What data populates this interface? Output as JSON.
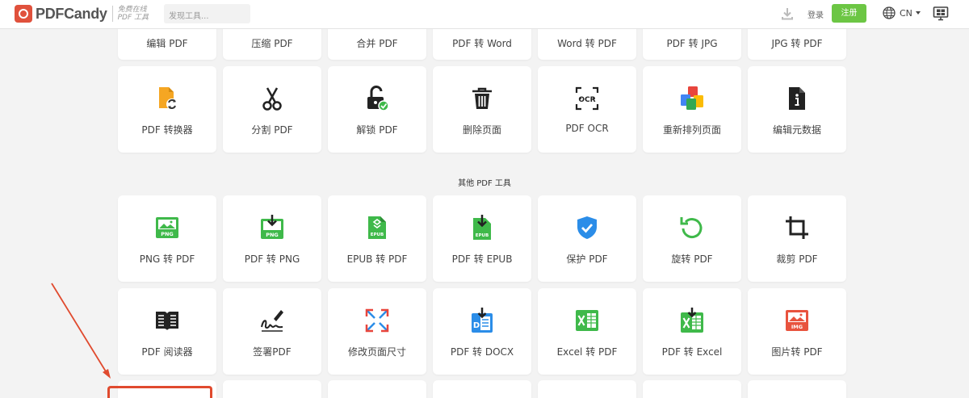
{
  "header": {
    "brand": "PDFCandy",
    "tagline_1": "免费在线",
    "tagline_2": "PDF 工具",
    "search_placeholder": "发现工具...",
    "login": "登录",
    "signup": "注册",
    "language": "CN"
  },
  "top_row": [
    {
      "label": "编辑 PDF"
    },
    {
      "label": "压缩 PDF"
    },
    {
      "label": "合并 PDF"
    },
    {
      "label": "PDF 转 Word"
    },
    {
      "label": "Word 转 PDF"
    },
    {
      "label": "PDF 转 JPG"
    },
    {
      "label": "JPG 转 PDF"
    }
  ],
  "row_2": [
    {
      "label": "PDF 转换器",
      "icon": "pdf-converter-icon"
    },
    {
      "label": "分割 PDF",
      "icon": "scissors-icon"
    },
    {
      "label": "解锁 PDF",
      "icon": "unlock-icon"
    },
    {
      "label": "删除页面",
      "icon": "trash-icon"
    },
    {
      "label": "PDF OCR",
      "icon": "ocr-icon"
    },
    {
      "label": "重新排列页面",
      "icon": "rearrange-icon"
    },
    {
      "label": "编辑元数据",
      "icon": "metadata-icon"
    }
  ],
  "section_title": "其他 PDF 工具",
  "row_3": [
    {
      "label": "PNG 转 PDF",
      "icon": "png-icon"
    },
    {
      "label": "PDF 转 PNG",
      "icon": "png-download-icon"
    },
    {
      "label": "EPUB 转 PDF",
      "icon": "epub-icon"
    },
    {
      "label": "PDF 转 EPUB",
      "icon": "epub-download-icon"
    },
    {
      "label": "保护 PDF",
      "icon": "shield-icon"
    },
    {
      "label": "旋转 PDF",
      "icon": "rotate-icon"
    },
    {
      "label": "裁剪 PDF",
      "icon": "crop-icon"
    }
  ],
  "row_4": [
    {
      "label": "PDF 阅读器",
      "icon": "book-icon"
    },
    {
      "label": "签署PDF",
      "icon": "signature-icon"
    },
    {
      "label": "修改页面尺寸",
      "icon": "resize-icon"
    },
    {
      "label": "PDF 转 DOCX",
      "icon": "docx-icon"
    },
    {
      "label": "Excel 转 PDF",
      "icon": "excel-icon"
    },
    {
      "label": "PDF 转 Excel",
      "icon": "excel-download-icon"
    },
    {
      "label": "图片转 PDF",
      "icon": "image-icon"
    }
  ],
  "colors": {
    "accent_green": "#6cc644",
    "brand_red": "#e0513c",
    "annotation_red": "#e04a2e"
  }
}
